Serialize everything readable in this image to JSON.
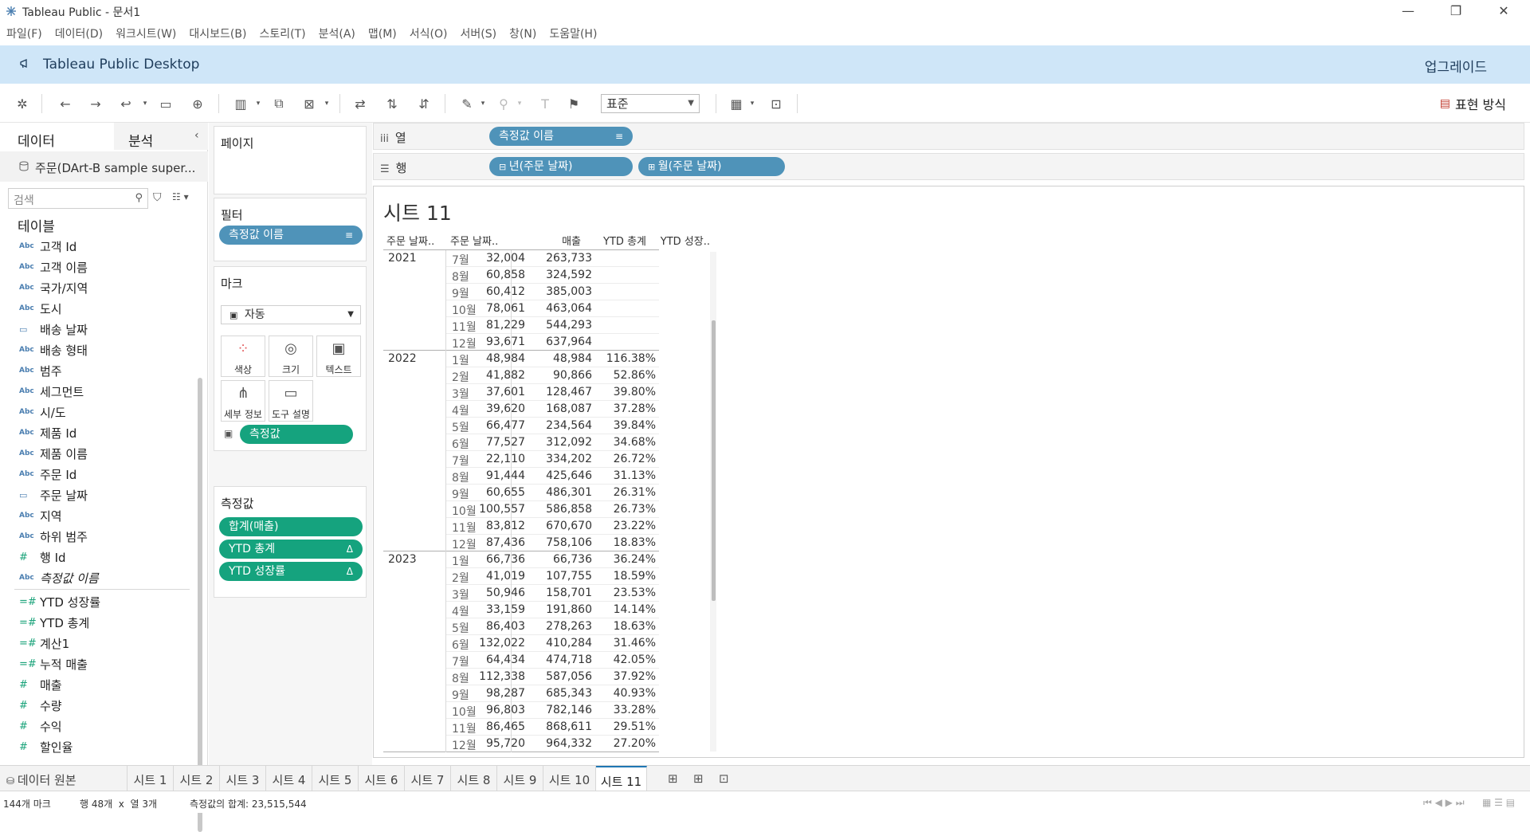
{
  "window": {
    "title": "Tableau Public - 문서1"
  },
  "menu": [
    "파일(F)",
    "데이터(D)",
    "워크시트(W)",
    "대시보드(B)",
    "스토리(T)",
    "분석(A)",
    "맵(M)",
    "서식(O)",
    "서버(S)",
    "창(N)",
    "도움말(H)"
  ],
  "banner": {
    "title": "Tableau Public Desktop",
    "upgrade": "업그레이드"
  },
  "toolbar": {
    "fit_select": "표준",
    "show_me": "표현 방식"
  },
  "datapane": {
    "tab_data": "데이터",
    "tab_analysis": "분석",
    "datasource": "주문(DArt-B sample super...",
    "search_placeholder": "검색",
    "tables_title": "테이블",
    "fields": [
      {
        "type": "Abc",
        "label": "고객 Id"
      },
      {
        "type": "Abc",
        "label": "고객 이름"
      },
      {
        "type": "Abc",
        "label": "국가/지역"
      },
      {
        "type": "Abc",
        "label": "도시"
      },
      {
        "type": "date",
        "label": "배송 날짜"
      },
      {
        "type": "Abc",
        "label": "배송 형태"
      },
      {
        "type": "Abc",
        "label": "범주"
      },
      {
        "type": "Abc",
        "label": "세그먼트"
      },
      {
        "type": "Abc",
        "label": "시/도"
      },
      {
        "type": "Abc",
        "label": "제품 Id"
      },
      {
        "type": "Abc",
        "label": "제품 이름"
      },
      {
        "type": "Abc",
        "label": "주문 Id"
      },
      {
        "type": "date",
        "label": "주문 날짜"
      },
      {
        "type": "Abc",
        "label": "지역"
      },
      {
        "type": "Abc",
        "label": "하위 범주"
      },
      {
        "type": "#",
        "label": "행 Id"
      },
      {
        "type": "Abc",
        "label": "측정값 이름",
        "italic": true
      }
    ],
    "measures": [
      {
        "type": "calc",
        "label": "YTD 성장률"
      },
      {
        "type": "calc",
        "label": "YTD 총계"
      },
      {
        "type": "calc",
        "label": "계산1"
      },
      {
        "type": "calc",
        "label": "누적 매출"
      },
      {
        "type": "#",
        "label": "매출"
      },
      {
        "type": "#",
        "label": "수량"
      },
      {
        "type": "#",
        "label": "수익"
      },
      {
        "type": "#",
        "label": "할인율"
      }
    ]
  },
  "shelves": {
    "pages_title": "페이지",
    "filters_title": "필터",
    "filter_pill": "측정값 이름",
    "marks_title": "마크",
    "marks_type": "자동",
    "mark_buttons": [
      "색상",
      "크기",
      "텍스트",
      "세부 정보",
      "도구 설명"
    ],
    "marks_text_pill": "측정값",
    "measures_title": "측정값",
    "measure_pills": [
      "합계(매출)",
      "YTD 총계",
      "YTD 성장률"
    ],
    "columns_label": "열",
    "columns_pill": "측정값 이름",
    "rows_label": "행",
    "rows_pills": [
      "년(주문 날짜)",
      "월(주문 날짜)"
    ]
  },
  "view": {
    "sheet_title": "시트 11",
    "headers": [
      "주문 날짜..",
      "주문 날짜..",
      "매출",
      "YTD 총계",
      "YTD 성장.."
    ],
    "groups": [
      {
        "year": "2021",
        "rows": [
          {
            "month": "7월",
            "sales": "32,004",
            "ytd": "263,733",
            "growth": ""
          },
          {
            "month": "8월",
            "sales": "60,858",
            "ytd": "324,592",
            "growth": ""
          },
          {
            "month": "9월",
            "sales": "60,412",
            "ytd": "385,003",
            "growth": ""
          },
          {
            "month": "10월",
            "sales": "78,061",
            "ytd": "463,064",
            "growth": ""
          },
          {
            "month": "11월",
            "sales": "81,229",
            "ytd": "544,293",
            "growth": ""
          },
          {
            "month": "12월",
            "sales": "93,671",
            "ytd": "637,964",
            "growth": ""
          }
        ]
      },
      {
        "year": "2022",
        "rows": [
          {
            "month": "1월",
            "sales": "48,984",
            "ytd": "48,984",
            "growth": "116.38%"
          },
          {
            "month": "2월",
            "sales": "41,882",
            "ytd": "90,866",
            "growth": "52.86%"
          },
          {
            "month": "3월",
            "sales": "37,601",
            "ytd": "128,467",
            "growth": "39.80%"
          },
          {
            "month": "4월",
            "sales": "39,620",
            "ytd": "168,087",
            "growth": "37.28%"
          },
          {
            "month": "5월",
            "sales": "66,477",
            "ytd": "234,564",
            "growth": "39.84%"
          },
          {
            "month": "6월",
            "sales": "77,527",
            "ytd": "312,092",
            "growth": "34.68%"
          },
          {
            "month": "7월",
            "sales": "22,110",
            "ytd": "334,202",
            "growth": "26.72%"
          },
          {
            "month": "8월",
            "sales": "91,444",
            "ytd": "425,646",
            "growth": "31.13%"
          },
          {
            "month": "9월",
            "sales": "60,655",
            "ytd": "486,301",
            "growth": "26.31%"
          },
          {
            "month": "10월",
            "sales": "100,557",
            "ytd": "586,858",
            "growth": "26.73%"
          },
          {
            "month": "11월",
            "sales": "83,812",
            "ytd": "670,670",
            "growth": "23.22%"
          },
          {
            "month": "12월",
            "sales": "87,436",
            "ytd": "758,106",
            "growth": "18.83%"
          }
        ]
      },
      {
        "year": "2023",
        "rows": [
          {
            "month": "1월",
            "sales": "66,736",
            "ytd": "66,736",
            "growth": "36.24%"
          },
          {
            "month": "2월",
            "sales": "41,019",
            "ytd": "107,755",
            "growth": "18.59%"
          },
          {
            "month": "3월",
            "sales": "50,946",
            "ytd": "158,701",
            "growth": "23.53%"
          },
          {
            "month": "4월",
            "sales": "33,159",
            "ytd": "191,860",
            "growth": "14.14%"
          },
          {
            "month": "5월",
            "sales": "86,403",
            "ytd": "278,263",
            "growth": "18.63%"
          },
          {
            "month": "6월",
            "sales": "132,022",
            "ytd": "410,284",
            "growth": "31.46%"
          },
          {
            "month": "7월",
            "sales": "64,434",
            "ytd": "474,718",
            "growth": "42.05%"
          },
          {
            "month": "8월",
            "sales": "112,338",
            "ytd": "587,056",
            "growth": "37.92%"
          },
          {
            "month": "9월",
            "sales": "98,287",
            "ytd": "685,343",
            "growth": "40.93%"
          },
          {
            "month": "10월",
            "sales": "96,803",
            "ytd": "782,146",
            "growth": "33.28%"
          },
          {
            "month": "11월",
            "sales": "86,465",
            "ytd": "868,611",
            "growth": "29.51%"
          },
          {
            "month": "12월",
            "sales": "95,720",
            "ytd": "964,332",
            "growth": "27.20%"
          }
        ]
      }
    ]
  },
  "tabs": {
    "datasource_tab": "데이터 원본",
    "sheets": [
      "시트 1",
      "시트 2",
      "시트 3",
      "시트 4",
      "시트 5",
      "시트 6",
      "시트 7",
      "시트 8",
      "시트 9",
      "시트 10",
      "시트 11"
    ],
    "active": "시트 11"
  },
  "status": {
    "marks": "144개 마크",
    "rows_cols": "행 48개  x  열 3개",
    "sum": "측정값의 합계: 23,515,544"
  },
  "colors": {
    "banner": "#cfe6f8",
    "dimension_pill": "#4f93b9",
    "measure_pill": "#15a37e",
    "active_tab_accent": "#1f77b4"
  }
}
